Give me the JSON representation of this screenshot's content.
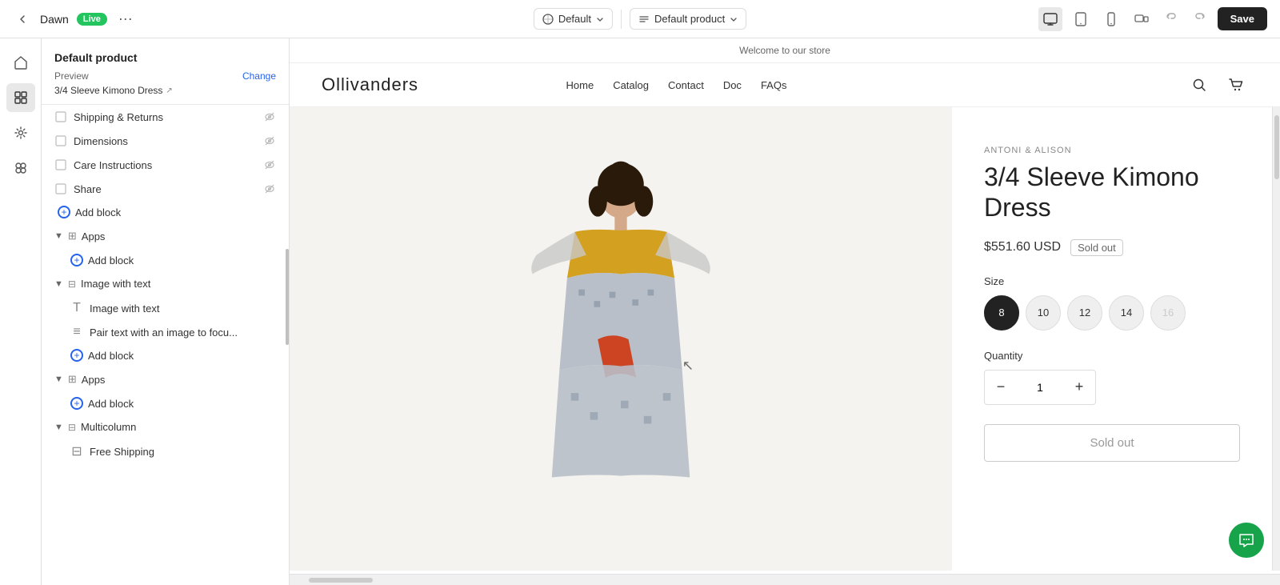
{
  "topbar": {
    "app_name": "Dawn",
    "live_label": "Live",
    "more_label": "···",
    "theme_default": "Default",
    "product_default": "Default product",
    "save_label": "Save"
  },
  "panel": {
    "title": "Default product",
    "preview_label": "Preview",
    "change_label": "Change",
    "product_name": "3/4 Sleeve Kimono Dress",
    "sections": {
      "shipping_returns": "Shipping & Returns",
      "dimensions": "Dimensions",
      "care_instructions": "Care Instructions",
      "share": "Share",
      "add_block": "Add block",
      "apps_1": "Apps",
      "image_with_text": "Image with text",
      "image_with_text_sub1": "Image with text",
      "image_with_text_sub2": "Pair text with an image to focu...",
      "apps_2": "Apps",
      "multicolumn": "Multicolumn",
      "free_shipping": "Free Shipping"
    }
  },
  "store": {
    "announcement": "Welcome to our store",
    "logo": "Ollivanders",
    "nav": [
      "Home",
      "Catalog",
      "Contact",
      "Doc",
      "FAQs"
    ],
    "brand": "ANTONI & ALISON",
    "product_title": "3/4 Sleeve Kimono Dress",
    "price": "$551.60 USD",
    "sold_out": "Sold out",
    "size_label": "Size",
    "sizes": [
      "8",
      "10",
      "12",
      "14",
      "16"
    ],
    "selected_size": "8",
    "quantity_label": "Quantity",
    "quantity_value": "1",
    "sold_out_btn": "Sold out"
  }
}
